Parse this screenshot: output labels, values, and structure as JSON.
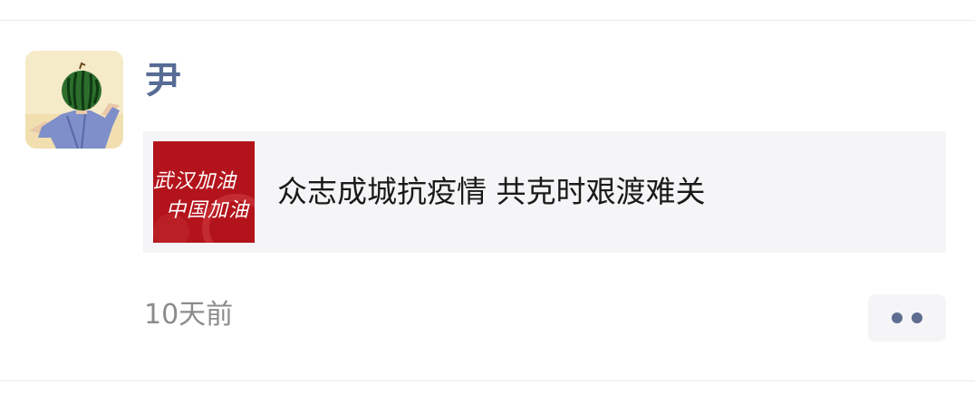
{
  "post": {
    "author": "尹",
    "avatar_icon": "watermelon-head-avatar",
    "link_card": {
      "thumbnail_lines": [
        "武汉加油",
        "中国加油"
      ],
      "title": "众志成城抗疫情 共克时艰渡难关"
    },
    "timestamp": "10天前",
    "more_icon": "two-dots-icon"
  },
  "colors": {
    "author_name": "#576b95",
    "card_background": "#f5f5f7",
    "thumbnail_red": "#b5121b",
    "timestamp": "#8c8c8c"
  }
}
